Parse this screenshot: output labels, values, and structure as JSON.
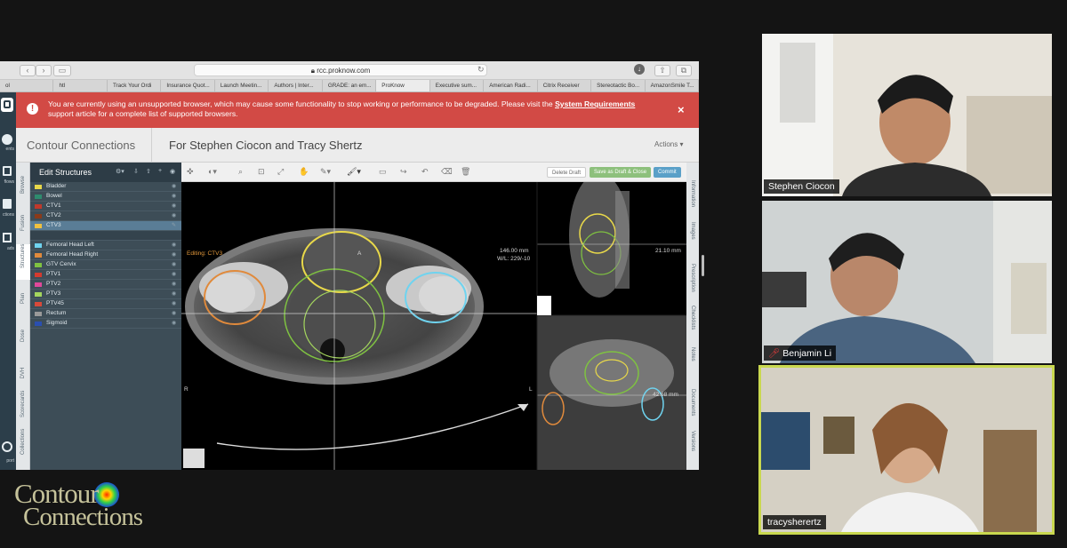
{
  "browser": {
    "url": "rcc.proknow.com",
    "tabs": [
      "ol",
      "htl",
      "Track Your Ordi",
      "Insurance Quot...",
      "Launch Meetin...",
      "Authors | Inter...",
      "GRADE: an em...",
      "ProKnow",
      "Executive sum...",
      "American Radi...",
      "Citrix Receiver",
      "Stereotactic Bo...",
      "AmazonSmile T..."
    ],
    "active_tab": 7
  },
  "warning": {
    "text_before": "You are currently using an unsupported browser, which may cause some functionality to stop working or performance to be degraded. Please visit the ",
    "link": "System Requirements",
    "text_after": " support article for a complete list of supported browsers.",
    "close": "×"
  },
  "app": {
    "title": "Contour Connections",
    "subtitle": "For Stephen Ciocon and Tracy Shertz",
    "actions": "Actions ▾"
  },
  "leftnav": [
    "ents",
    "flows",
    "ctions",
    "ads",
    "port"
  ],
  "vtabs": [
    "Browse",
    "Fusion",
    "Structures",
    "Plan",
    "Dose",
    "DVH",
    "Scorecards",
    "Collections"
  ],
  "rtabs": [
    "Information",
    "Images",
    "Prescription",
    "Checklists",
    "Notes",
    "Documents",
    "Versions"
  ],
  "structures": {
    "title": "Edit Structures",
    "items": [
      {
        "label": "Bladder",
        "color": "#e8d84a"
      },
      {
        "label": "Bowel",
        "color": "#2e8b6e"
      },
      {
        "label": "CTV1",
        "color": "#c0392b"
      },
      {
        "label": "CTV2",
        "color": "#8a3a1a"
      },
      {
        "label": "CTV3",
        "color": "#f0c040"
      },
      {
        "label": "Femoral Head Left",
        "color": "#6fd3ef"
      },
      {
        "label": "Femoral Head Right",
        "color": "#e08a3c"
      },
      {
        "label": "GTV Cervix",
        "color": "#7fc241"
      },
      {
        "label": "PTV1",
        "color": "#d43a2f"
      },
      {
        "label": "PTV2",
        "color": "#e0489a"
      },
      {
        "label": "PTV3",
        "color": "#a4d65e"
      },
      {
        "label": "PTV45",
        "color": "#d8493a"
      },
      {
        "label": "Rectum",
        "color": "#9a9a9a"
      },
      {
        "label": "Sigmoid",
        "color": "#2a4fb0"
      }
    ],
    "selected": 4
  },
  "viewer": {
    "editing": "Editing: CTV3",
    "dist1": "146.00 mm",
    "wl": "W/L: 229/-10",
    "dist2": "21.10 mm",
    "dist3": "42.68 mm",
    "btn_delete": "Delete Draft",
    "btn_save": "Save as Draft & Close",
    "btn_commit": "Commit",
    "orient": {
      "a": "A",
      "p": "P",
      "r": "R",
      "l": "L"
    }
  },
  "participants": [
    {
      "name": "Stephen Ciocon"
    },
    {
      "name": "Benjamin Li"
    },
    {
      "name": "tracysherertz"
    }
  ],
  "logo": {
    "line1": "Contour",
    "line2": "Connections"
  },
  "colors": {
    "warning": "#d24a45",
    "speaker_border": "#c9d84f",
    "panel": "#3d4d57"
  }
}
